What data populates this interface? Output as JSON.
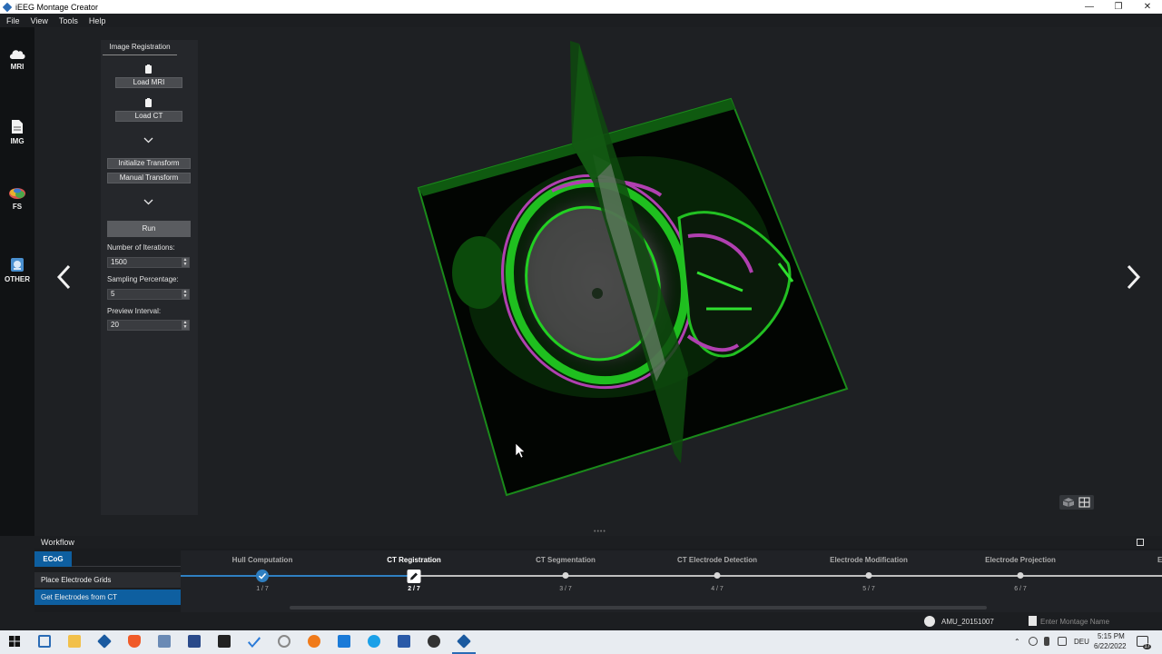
{
  "window": {
    "title": "iEEG Montage Creator"
  },
  "menu": [
    "File",
    "View",
    "Tools",
    "Help"
  ],
  "sidebar": {
    "items": [
      {
        "label": "MRI",
        "icon": "cloud-icon"
      },
      {
        "label": "IMG",
        "icon": "document-icon"
      },
      {
        "label": "FS",
        "icon": "brain-icon"
      },
      {
        "label": "OTHER",
        "icon": "monitor-icon"
      }
    ]
  },
  "panel": {
    "tab_label": "Image Registration",
    "load_mri": "Load MRI",
    "load_ct": "Load CT",
    "initialize_transform": "Initialize Transform",
    "manual_transform": "Manual Transform",
    "run": "Run",
    "iterations_label": "Number of Iterations:",
    "iterations_value": "1500",
    "sampling_label": "Sampling Percentage:",
    "sampling_value": "5",
    "preview_label": "Preview Interval:",
    "preview_value": "20"
  },
  "workflow": {
    "title": "Workflow",
    "tab": "ECoG",
    "items": [
      "Place Electrode Grids",
      "Get Electrodes from CT"
    ],
    "selected_index": 1,
    "steps": [
      {
        "name": "Hull Computation",
        "num": "1 / 7",
        "state": "done"
      },
      {
        "name": "CT Registration",
        "num": "2 / 7",
        "state": "current"
      },
      {
        "name": "CT Segmentation",
        "num": "3 / 7",
        "state": "pending"
      },
      {
        "name": "CT Electrode Detection",
        "num": "4 / 7",
        "state": "pending"
      },
      {
        "name": "Electrode Modification",
        "num": "5 / 7",
        "state": "pending"
      },
      {
        "name": "Electrode Projection",
        "num": "6 / 7",
        "state": "pending"
      },
      {
        "name": "Electrod",
        "num": "",
        "state": "pending"
      }
    ]
  },
  "status": {
    "user": "AMU_20151007",
    "montage_placeholder": "Enter Montage Name"
  },
  "taskbar": {
    "language": "DEU",
    "time": "5:15 PM",
    "date": "6/22/2022",
    "notification_count": "17"
  },
  "colors": {
    "accent": "#0e5fa0",
    "progress_done": "#2f7fc1",
    "ct_overlay": "#1aa71a",
    "mri_overlay": "#c04ec0"
  }
}
